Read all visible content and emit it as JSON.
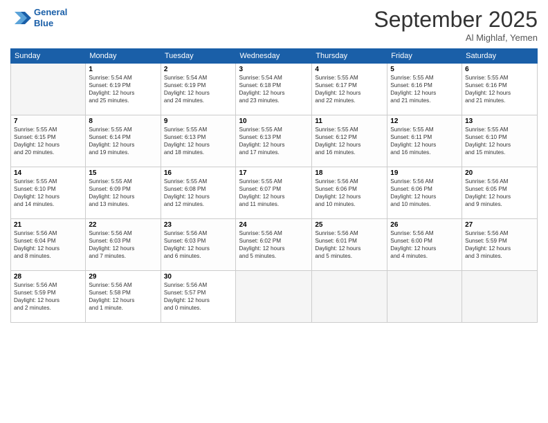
{
  "header": {
    "logo_line1": "General",
    "logo_line2": "Blue",
    "month": "September 2025",
    "location": "Al Mighlaf, Yemen"
  },
  "weekdays": [
    "Sunday",
    "Monday",
    "Tuesday",
    "Wednesday",
    "Thursday",
    "Friday",
    "Saturday"
  ],
  "weeks": [
    [
      {
        "day": "",
        "info": ""
      },
      {
        "day": "1",
        "info": "Sunrise: 5:54 AM\nSunset: 6:19 PM\nDaylight: 12 hours\nand 25 minutes."
      },
      {
        "day": "2",
        "info": "Sunrise: 5:54 AM\nSunset: 6:19 PM\nDaylight: 12 hours\nand 24 minutes."
      },
      {
        "day": "3",
        "info": "Sunrise: 5:54 AM\nSunset: 6:18 PM\nDaylight: 12 hours\nand 23 minutes."
      },
      {
        "day": "4",
        "info": "Sunrise: 5:55 AM\nSunset: 6:17 PM\nDaylight: 12 hours\nand 22 minutes."
      },
      {
        "day": "5",
        "info": "Sunrise: 5:55 AM\nSunset: 6:16 PM\nDaylight: 12 hours\nand 21 minutes."
      },
      {
        "day": "6",
        "info": "Sunrise: 5:55 AM\nSunset: 6:16 PM\nDaylight: 12 hours\nand 21 minutes."
      }
    ],
    [
      {
        "day": "7",
        "info": "Sunrise: 5:55 AM\nSunset: 6:15 PM\nDaylight: 12 hours\nand 20 minutes."
      },
      {
        "day": "8",
        "info": "Sunrise: 5:55 AM\nSunset: 6:14 PM\nDaylight: 12 hours\nand 19 minutes."
      },
      {
        "day": "9",
        "info": "Sunrise: 5:55 AM\nSunset: 6:13 PM\nDaylight: 12 hours\nand 18 minutes."
      },
      {
        "day": "10",
        "info": "Sunrise: 5:55 AM\nSunset: 6:13 PM\nDaylight: 12 hours\nand 17 minutes."
      },
      {
        "day": "11",
        "info": "Sunrise: 5:55 AM\nSunset: 6:12 PM\nDaylight: 12 hours\nand 16 minutes."
      },
      {
        "day": "12",
        "info": "Sunrise: 5:55 AM\nSunset: 6:11 PM\nDaylight: 12 hours\nand 16 minutes."
      },
      {
        "day": "13",
        "info": "Sunrise: 5:55 AM\nSunset: 6:10 PM\nDaylight: 12 hours\nand 15 minutes."
      }
    ],
    [
      {
        "day": "14",
        "info": "Sunrise: 5:55 AM\nSunset: 6:10 PM\nDaylight: 12 hours\nand 14 minutes."
      },
      {
        "day": "15",
        "info": "Sunrise: 5:55 AM\nSunset: 6:09 PM\nDaylight: 12 hours\nand 13 minutes."
      },
      {
        "day": "16",
        "info": "Sunrise: 5:55 AM\nSunset: 6:08 PM\nDaylight: 12 hours\nand 12 minutes."
      },
      {
        "day": "17",
        "info": "Sunrise: 5:55 AM\nSunset: 6:07 PM\nDaylight: 12 hours\nand 11 minutes."
      },
      {
        "day": "18",
        "info": "Sunrise: 5:56 AM\nSunset: 6:06 PM\nDaylight: 12 hours\nand 10 minutes."
      },
      {
        "day": "19",
        "info": "Sunrise: 5:56 AM\nSunset: 6:06 PM\nDaylight: 12 hours\nand 10 minutes."
      },
      {
        "day": "20",
        "info": "Sunrise: 5:56 AM\nSunset: 6:05 PM\nDaylight: 12 hours\nand 9 minutes."
      }
    ],
    [
      {
        "day": "21",
        "info": "Sunrise: 5:56 AM\nSunset: 6:04 PM\nDaylight: 12 hours\nand 8 minutes."
      },
      {
        "day": "22",
        "info": "Sunrise: 5:56 AM\nSunset: 6:03 PM\nDaylight: 12 hours\nand 7 minutes."
      },
      {
        "day": "23",
        "info": "Sunrise: 5:56 AM\nSunset: 6:03 PM\nDaylight: 12 hours\nand 6 minutes."
      },
      {
        "day": "24",
        "info": "Sunrise: 5:56 AM\nSunset: 6:02 PM\nDaylight: 12 hours\nand 5 minutes."
      },
      {
        "day": "25",
        "info": "Sunrise: 5:56 AM\nSunset: 6:01 PM\nDaylight: 12 hours\nand 5 minutes."
      },
      {
        "day": "26",
        "info": "Sunrise: 5:56 AM\nSunset: 6:00 PM\nDaylight: 12 hours\nand 4 minutes."
      },
      {
        "day": "27",
        "info": "Sunrise: 5:56 AM\nSunset: 5:59 PM\nDaylight: 12 hours\nand 3 minutes."
      }
    ],
    [
      {
        "day": "28",
        "info": "Sunrise: 5:56 AM\nSunset: 5:59 PM\nDaylight: 12 hours\nand 2 minutes."
      },
      {
        "day": "29",
        "info": "Sunrise: 5:56 AM\nSunset: 5:58 PM\nDaylight: 12 hours\nand 1 minute."
      },
      {
        "day": "30",
        "info": "Sunrise: 5:56 AM\nSunset: 5:57 PM\nDaylight: 12 hours\nand 0 minutes."
      },
      {
        "day": "",
        "info": ""
      },
      {
        "day": "",
        "info": ""
      },
      {
        "day": "",
        "info": ""
      },
      {
        "day": "",
        "info": ""
      }
    ]
  ]
}
